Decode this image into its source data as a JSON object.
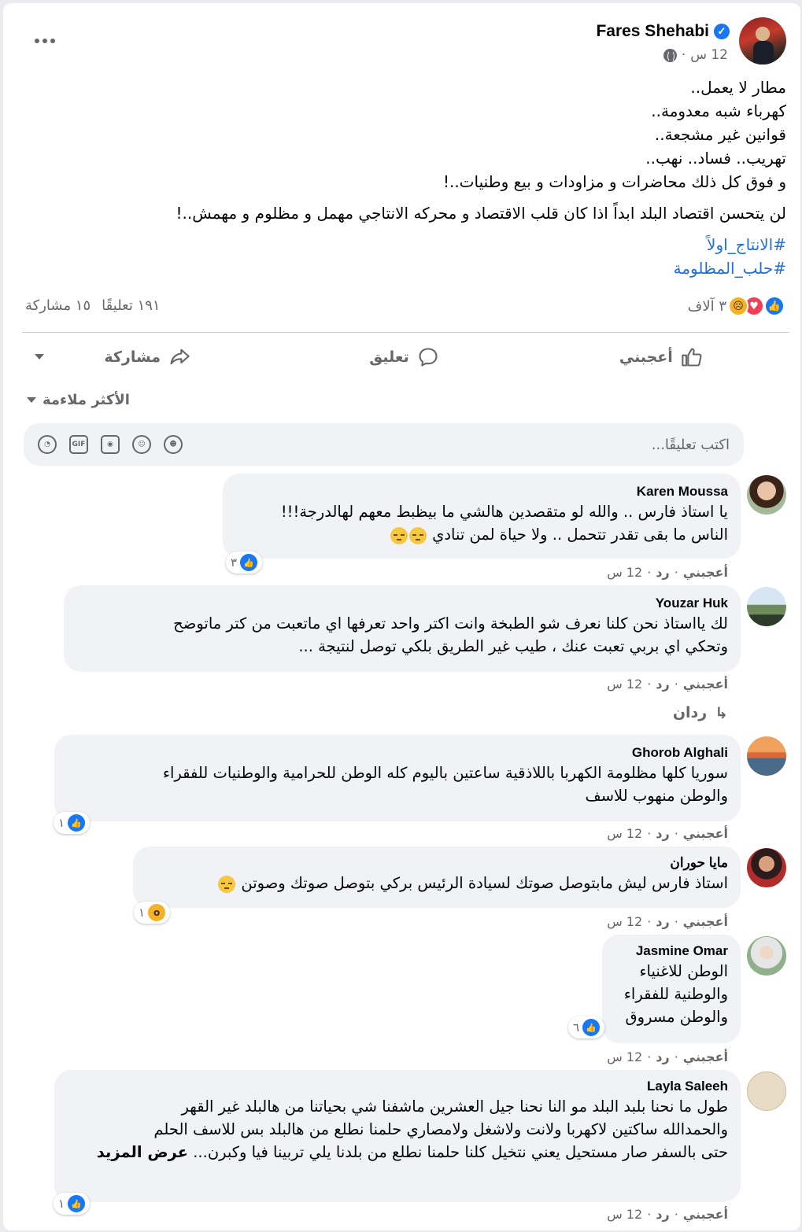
{
  "post": {
    "author": "Fares Shehabi",
    "time": "12 س",
    "lines": [
      "مطار لا يعمل..",
      "كهرباء شبه معدومة..",
      "قوانين غير مشجعة..",
      "تهريب.. فساد.. نهب..",
      "و فوق كل ذلك محاضرات و مزاودات و بيع وطنيات..!"
    ],
    "conclusion": "لن يتحسن اقتصاد البلد ابداً اذا كان قلب الاقتصاد و محركه الانتاجي مهمل و مظلوم و مهمش..!",
    "hashtags": [
      "#الانتاج_اولاً",
      "#حلب_المظلومة"
    ],
    "reactions_count": "٣ آلاف",
    "comments_count": "١٩١ تعليقًا",
    "shares_count": "١٥ مشاركة"
  },
  "actions": {
    "like": "أعجبني",
    "comment": "تعليق",
    "share": "مشاركة"
  },
  "sort_label": "الأكثر ملاءمة",
  "comment_input": {
    "placeholder": "اكتب تعليقًا..."
  },
  "comment_actions": {
    "like": "أعجبني",
    "reply": "رد",
    "time": "12 س"
  },
  "comments": [
    {
      "name": "Karen Moussa",
      "lines": [
        "يا استاذ فارس .. والله لو متقصدين هالشي ما بيظبط معهم لهالدرجة!!!",
        "الناس ما بقى تقدر تتحمل .. ولا حياة لمن تنادي"
      ],
      "reaction_count": "٣"
    },
    {
      "name": "Youzar Huk",
      "lines": [
        "لك يااستاذ نحن كلنا نعرف شو الطبخة وانت اكتر واحد تعرفها اي ماتعبت من كتر ماتوضح",
        "وتحكي اي بربي تعبت عنك ، طيب غير الطريق بلكي توصل لنتيجة ..."
      ],
      "replies_label": "ردان"
    },
    {
      "name": "Ghorob Alghali",
      "lines": [
        "سوريا كلها مظلومة الكهربا باللاذقية ساعتين باليوم كله الوطن للحرامية والوطنيات للفقراء",
        "والوطن منهوب للاسف"
      ],
      "reaction_count": "١"
    },
    {
      "name": "مايا حوران",
      "lines": [
        "استاذ فارس ليش مابتوصل صوتك لسيادة الرئيس بركي بتوصل صوتك وصوتن"
      ],
      "reaction_count": "١"
    },
    {
      "name": "Jasmine Omar",
      "lines": [
        "الوطن للاغنياء",
        "والوطنية للفقراء",
        "والوطن مسروق"
      ],
      "reaction_count": "٦"
    },
    {
      "name": "Layla Saleeh",
      "lines": [
        "طول ما نحنا بلبد البلد مو النا نحنا جيل العشرين ماشفنا شي بحياتنا من هالبلد غير القهر",
        "والحمدالله ساكتين لاكهربا ولانت ولاشغل ولامصاري حلمنا نطلع من هالبلد بس للاسف الحلم",
        "حتى بالسفر صار مستحيل يعني نتخيل كلنا حلمنا نطلع من بلدنا يلي تربينا فيا وكبرن..."
      ],
      "see_more": "عرض المزيد",
      "reaction_count": "١"
    }
  ],
  "colors": {
    "accent": "#1877f2",
    "hashtag": "#216fdb",
    "muted": "#65676b",
    "bubble": "#f0f2f5"
  }
}
